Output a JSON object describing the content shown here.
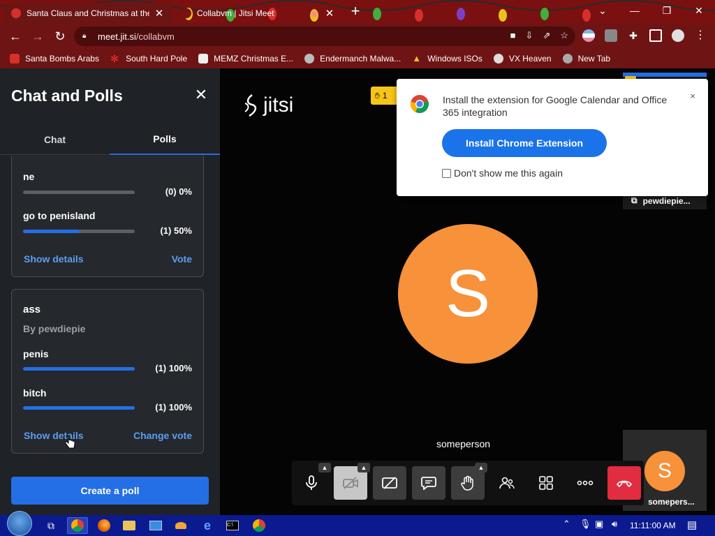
{
  "browser": {
    "tabs": [
      {
        "title": "Santa Claus and Christmas at the",
        "active": true
      },
      {
        "title": "Collabvm | Jitsi Meet",
        "active": false
      }
    ],
    "url_host": "meet.jit.si",
    "url_path": "/collabvm",
    "bookmarks": [
      {
        "label": "Santa Bombs Arabs",
        "icon": "santa-icon"
      },
      {
        "label": "South Hard Pole",
        "icon": "flake-icon"
      },
      {
        "label": "MEMZ Christmas E...",
        "icon": "memz-icon"
      },
      {
        "label": "Endermanch Malwa...",
        "icon": "enderman-icon"
      },
      {
        "label": "Windows ISOs",
        "icon": "tree-icon"
      },
      {
        "label": "VX Heaven",
        "icon": "vx-icon"
      },
      {
        "label": "New Tab",
        "icon": "globe-icon"
      }
    ]
  },
  "sidebar": {
    "title": "Chat and Polls",
    "tabs": [
      {
        "label": "Chat",
        "active": false
      },
      {
        "label": "Polls",
        "active": true
      }
    ],
    "polls": [
      {
        "question": "",
        "author": "",
        "options": [
          {
            "label": "ne",
            "stat": "(0) 0%",
            "fraction": 0
          },
          {
            "label": "go to penisland",
            "stat": "(1) 50%",
            "fraction": 0.5
          }
        ],
        "show_details": "Show details",
        "action": "Vote"
      },
      {
        "question": "ass",
        "author": "By pewdiepie",
        "options": [
          {
            "label": "penis",
            "stat": "(1) 100%",
            "fraction": 1
          },
          {
            "label": "bitch",
            "stat": "(1) 100%",
            "fraction": 1
          }
        ],
        "show_details": "Show details",
        "action": "Change vote"
      }
    ],
    "create_poll": "Create a poll"
  },
  "stage": {
    "logo": "jitsi",
    "raised_hands": "1",
    "extension_popup": {
      "message": "Install the extension for Google Calendar and Office 365 integration",
      "close": "×",
      "install_button": "Install Chrome Extension",
      "dont_show": "Don't show me this again"
    },
    "top_thumbnail_name": "pewdiepie...",
    "speaker_initial": "S",
    "speaker_name": "someperson",
    "bottom_thumbnail_initial": "S",
    "bottom_thumbnail_name": "somepers...",
    "avatar_color": "#f7913a"
  },
  "taskbar": {
    "clock": "11:11:00 AM"
  },
  "colors": {
    "accent": "#246fe5",
    "hangup": "#e12d3f",
    "browser_frame": "#6e1414"
  }
}
